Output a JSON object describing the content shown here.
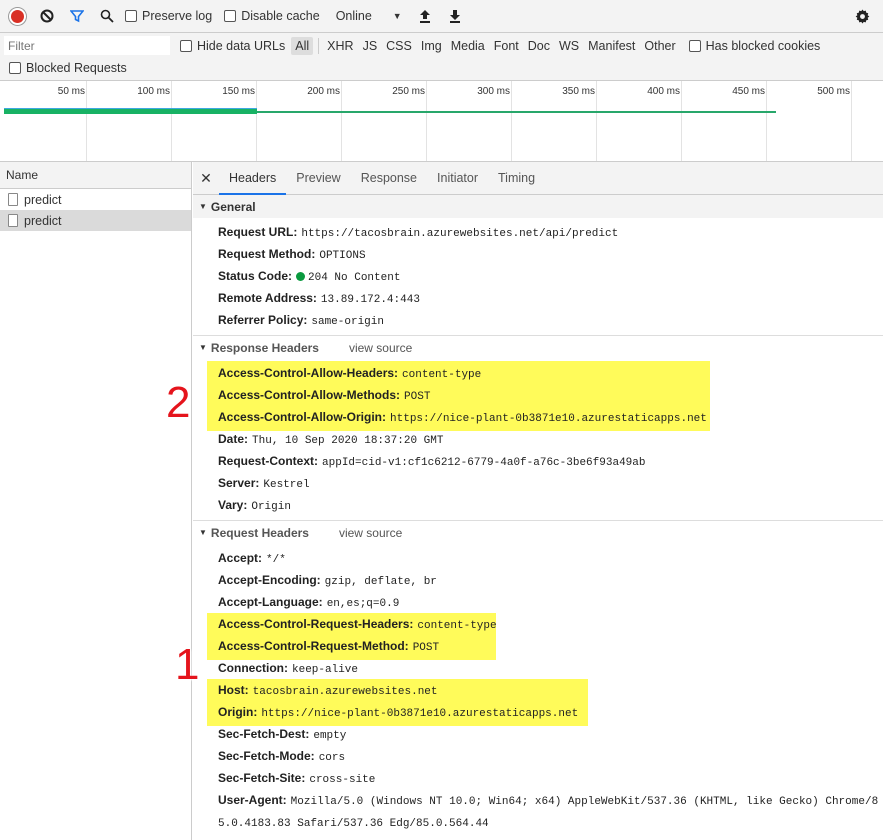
{
  "toolbar": {
    "preserve_log": "Preserve log",
    "disable_cache": "Disable cache",
    "throttling": "Online"
  },
  "filter": {
    "placeholder": "Filter",
    "hide_data_urls": "Hide data URLs",
    "types": [
      "All",
      "XHR",
      "JS",
      "CSS",
      "Img",
      "Media",
      "Font",
      "Doc",
      "WS",
      "Manifest",
      "Other"
    ],
    "has_blocked_cookies": "Has blocked cookies",
    "blocked_requests": "Blocked Requests"
  },
  "timeline": {
    "ticks": [
      "50 ms",
      "100 ms",
      "150 ms",
      "200 ms",
      "250 ms",
      "300 ms",
      "350 ms",
      "400 ms",
      "450 ms",
      "500 ms"
    ]
  },
  "request_list": {
    "header": "Name",
    "items": [
      "predict",
      "predict"
    ]
  },
  "tabs": [
    "Headers",
    "Preview",
    "Response",
    "Initiator",
    "Timing"
  ],
  "general": {
    "title": "General",
    "rows": [
      {
        "k": "Request URL:",
        "v": "https://tacosbrain.azurewebsites.net/api/predict"
      },
      {
        "k": "Request Method:",
        "v": "OPTIONS"
      },
      {
        "k": "Status Code:",
        "v": "204 No Content"
      },
      {
        "k": "Remote Address:",
        "v": "13.89.172.4:443"
      },
      {
        "k": "Referrer Policy:",
        "v": "same-origin"
      }
    ]
  },
  "response_headers": {
    "title": "Response Headers",
    "view_source": "view source",
    "rows": [
      {
        "k": "Access-Control-Allow-Headers:",
        "v": "content-type"
      },
      {
        "k": "Access-Control-Allow-Methods:",
        "v": "POST"
      },
      {
        "k": "Access-Control-Allow-Origin:",
        "v": "https://nice-plant-0b3871e10.azurestaticapps.net"
      },
      {
        "k": "Date:",
        "v": "Thu, 10 Sep 2020 18:37:20 GMT"
      },
      {
        "k": "Request-Context:",
        "v": "appId=cid-v1:cf1c6212-6779-4a0f-a76c-3be6f93a49ab"
      },
      {
        "k": "Server:",
        "v": "Kestrel"
      },
      {
        "k": "Vary:",
        "v": "Origin"
      }
    ]
  },
  "request_headers": {
    "title": "Request Headers",
    "view_source": "view source",
    "rows": [
      {
        "k": "Accept:",
        "v": "*/*"
      },
      {
        "k": "Accept-Encoding:",
        "v": "gzip, deflate, br"
      },
      {
        "k": "Accept-Language:",
        "v": "en,es;q=0.9"
      },
      {
        "k": "Access-Control-Request-Headers:",
        "v": "content-type"
      },
      {
        "k": "Access-Control-Request-Method:",
        "v": "POST"
      },
      {
        "k": "Connection:",
        "v": "keep-alive"
      },
      {
        "k": "Host:",
        "v": "tacosbrain.azurewebsites.net"
      },
      {
        "k": "Origin:",
        "v": "https://nice-plant-0b3871e10.azurestaticapps.net"
      },
      {
        "k": "Sec-Fetch-Dest:",
        "v": "empty"
      },
      {
        "k": "Sec-Fetch-Mode:",
        "v": "cors"
      },
      {
        "k": "Sec-Fetch-Site:",
        "v": "cross-site"
      },
      {
        "k": "User-Agent:",
        "v": "Mozilla/5.0 (Windows NT 10.0; Win64; x64) AppleWebKit/537.36 (KHTML, like Gecko) Chrome/8"
      },
      {
        "k": "",
        "v": "5.0.4183.83 Safari/537.36 Edg/85.0.564.44"
      }
    ]
  },
  "annotations": {
    "one": "1",
    "two": "2"
  },
  "colors": {
    "highlight": "#fff559",
    "annotation": "#e5141c",
    "status_ok": "#0a9a3f",
    "active_tab": "#1a73e8"
  }
}
